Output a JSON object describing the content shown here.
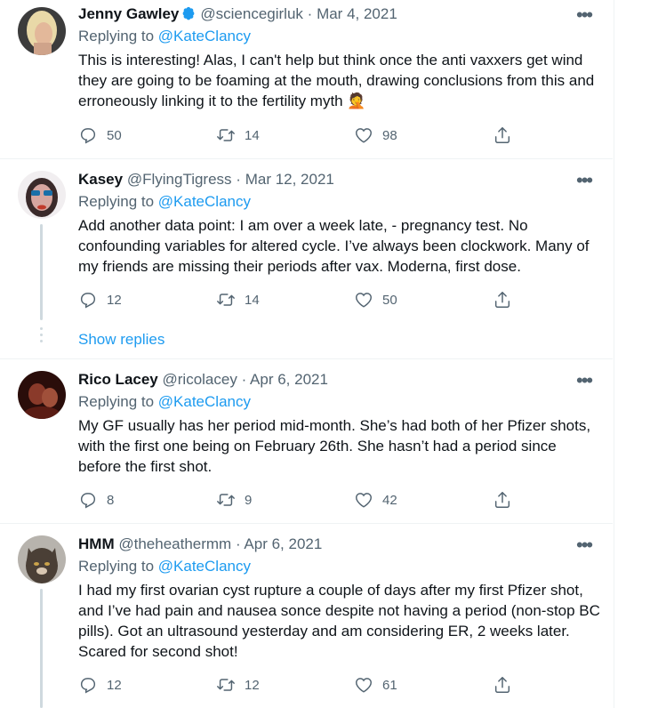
{
  "tweets": [
    {
      "name": "Jenny Gawley",
      "handle": "@sciencegirluk",
      "sep": "·",
      "date": "Mar 4, 2021",
      "reply_prefix": "Replying to ",
      "reply_to": "@KateClancy",
      "text": "This is interesting! Alas, I can't help but think once the anti vaxxers get wind they are going to be foaming at the mouth, drawing conclusions from this and erroneously linking it to the fertility myth 🤦",
      "replies": "50",
      "retweets": "14",
      "likes": "98",
      "verified": true
    },
    {
      "name": "Kasey",
      "handle": "@FlyingTigress",
      "sep": "·",
      "date": "Mar 12, 2021",
      "reply_prefix": "Replying to ",
      "reply_to": "@KateClancy",
      "text": "Add another data point: I am over a week late, - pregnancy test. No confounding variables for altered cycle. I’ve always been clockwork. Many of my friends are missing their periods after vax. Moderna, first dose.",
      "replies": "12",
      "retweets": "14",
      "likes": "50",
      "show_replies": "Show replies"
    },
    {
      "name": "Rico Lacey",
      "handle": "@ricolacey",
      "sep": "·",
      "date": "Apr 6, 2021",
      "reply_prefix": "Replying to ",
      "reply_to": "@KateClancy",
      "text": "My GF usually has her period mid-month. She’s had both of her Pfizer shots, with the first one being on February 26th. She hasn’t had a period since before the first shot.",
      "replies": "8",
      "retweets": "9",
      "likes": "42"
    },
    {
      "name": "HMM",
      "handle": "@theheathermm",
      "sep": "·",
      "date": "Apr 6, 2021",
      "reply_prefix": "Replying to ",
      "reply_to": "@KateClancy",
      "text": "I had my first ovarian cyst rupture a couple of days after my first Pfizer shot, and I’ve had pain and nausea sonce despite not having a period (non-stop BC pills). Got an ultrasound yesterday and am considering ER, 2 weeks later. Scared for second shot!",
      "replies": "12",
      "retweets": "12",
      "likes": "61"
    }
  ],
  "more_label": "•••",
  "colors": {
    "accent": "#1d9bf0",
    "secondary_text": "#536471",
    "divider": "#eff3f4"
  }
}
